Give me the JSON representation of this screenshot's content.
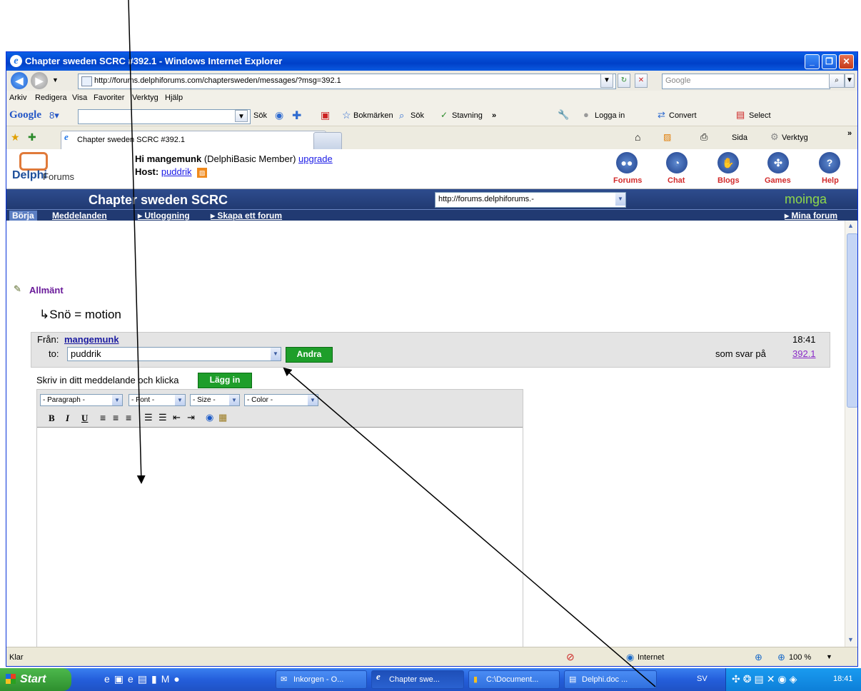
{
  "window": {
    "title": "Chapter sweden SCRC #392.1 - Windows Internet Explorer",
    "address": "http://forums.delphiforums.com/chaptersweden/messages/?msg=392.1",
    "search_placeholder": "Google"
  },
  "menu": [
    "Arkiv",
    "Redigera",
    "Visa",
    "Favoriter",
    "Verktyg",
    "Hjälp"
  ],
  "google_toolbar": {
    "brand": "Google",
    "search_label": "Sök",
    "bookmarks": "Bokmärken",
    "search2": "Sök",
    "spelling": "Stavning",
    "more": "»",
    "login": "Logga in",
    "convert": "Convert",
    "select": "Select"
  },
  "tabs": {
    "active_tab": "Chapter sweden SCRC #392.1",
    "page": "Sida",
    "tools": "Verktyg",
    "more": "»"
  },
  "site": {
    "logo_bold": "Delphi",
    "logo_rest": "Forums",
    "greeting_prefix": "Hi mangemunk",
    "member": "(DelphiBasic Member)",
    "upgrade": "upgrade",
    "host_label": "Host:",
    "host": "puddrik",
    "nav_icons": [
      "Forums",
      "Chat",
      "Blogs",
      "Games",
      "Help"
    ],
    "forum_title": "Chapter sweden SCRC",
    "forum_select": "http://forums.delphiforums.-",
    "brand": "moinga",
    "nav": [
      "Börja",
      "Meddelanden",
      "▸ Utloggning",
      "▸ Skapa ett forum"
    ],
    "my_forums": "▸ Mina forum"
  },
  "post": {
    "category": "Allmänt",
    "subject": "↳Snö = motion",
    "from_label": "Från:",
    "from": "mangemunk",
    "to_label": "to:",
    "to": "puddrik",
    "change_button": "Andra",
    "time": "18:41",
    "reply_prefix": "som svar på",
    "reply_to": "392.1",
    "instruction": "Skriv in ditt meddelande och klicka",
    "post_button": "Lägg in",
    "editor_selects": [
      "- Paragraph -",
      "- Font -",
      "- Size -",
      "- Color -"
    ],
    "format_buttons": [
      "B",
      "I",
      "U"
    ]
  },
  "status": {
    "text": "Klar",
    "zone": "Internet",
    "zoom": "100 %"
  },
  "taskbar": {
    "start": "Start",
    "items": [
      "Inkorgen - O...",
      "Chapter swe...",
      "C:\\Document...",
      "Delphi.doc ..."
    ],
    "lang": "SV",
    "clock": "18:41"
  }
}
